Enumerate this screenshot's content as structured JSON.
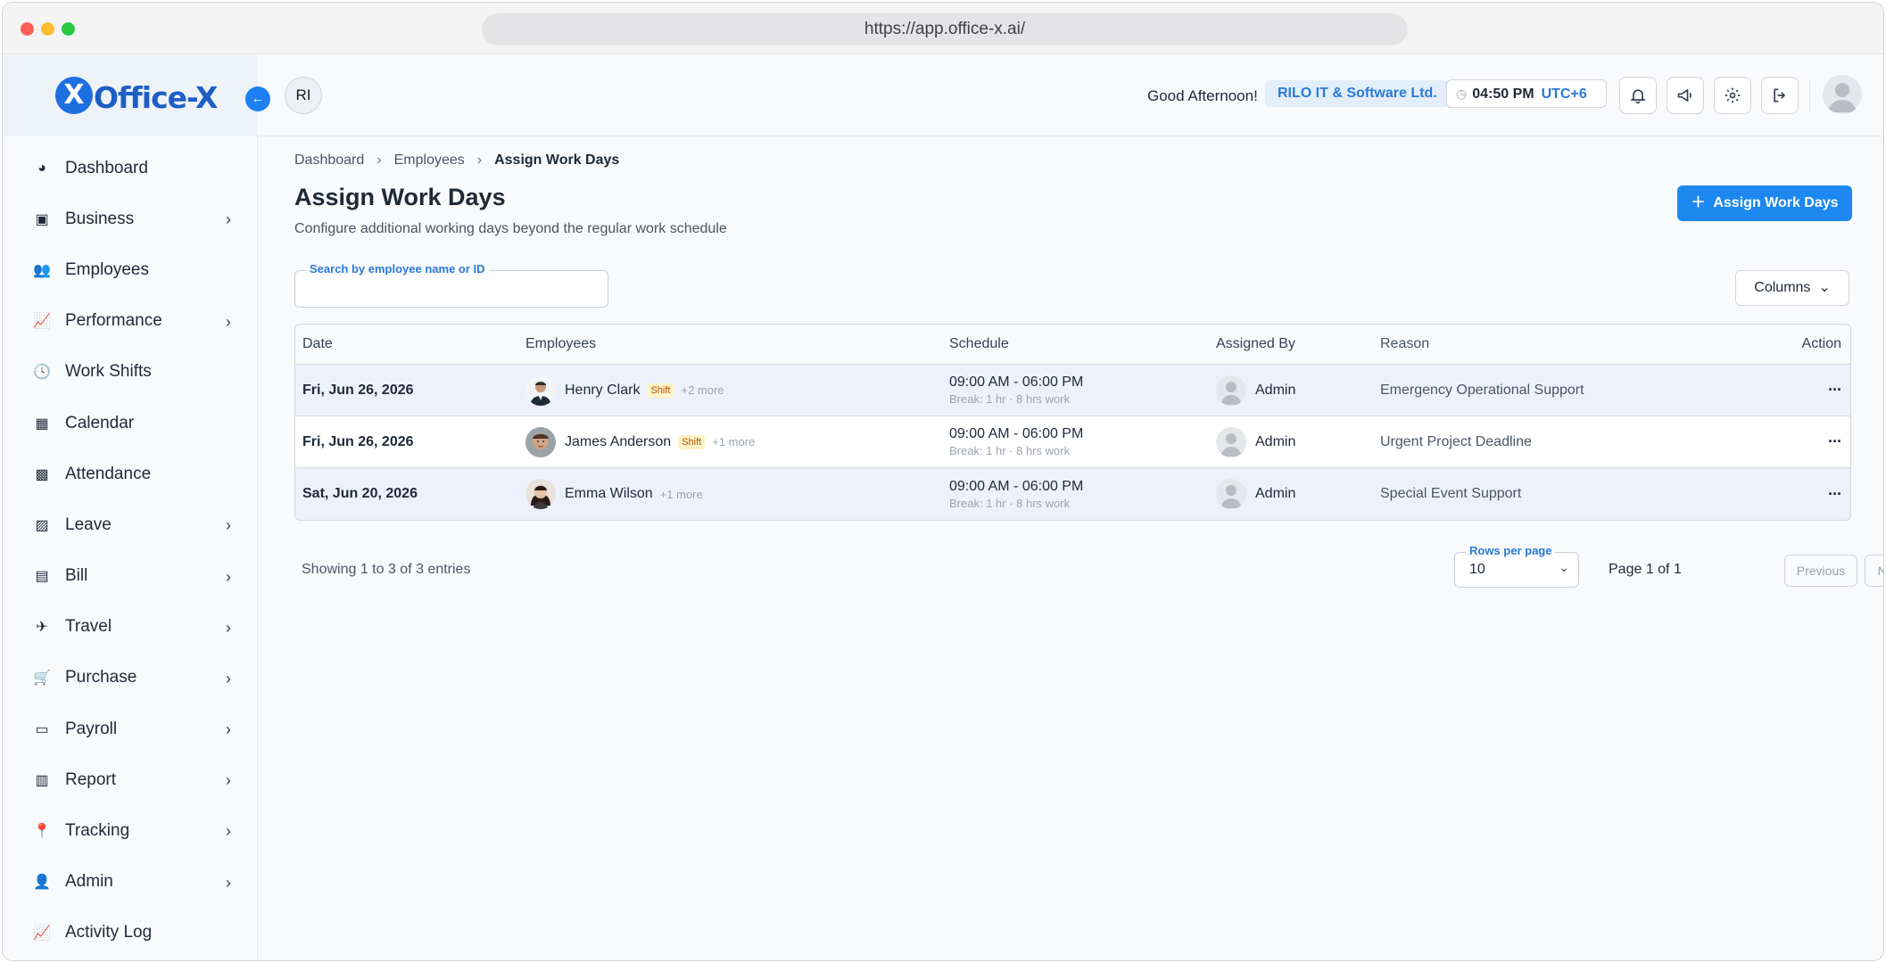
{
  "browser": {
    "url": "https://app.office-x.ai/"
  },
  "brand": {
    "mark": "X",
    "name": "Office-X"
  },
  "sidebar": {
    "items": [
      {
        "label": "Dashboard",
        "icon": "gauge-icon",
        "glyph": "◕",
        "has_children": false
      },
      {
        "label": "Business",
        "icon": "briefcase-icon",
        "glyph": "▣",
        "has_children": true
      },
      {
        "label": "Employees",
        "icon": "users-icon",
        "glyph": "👥",
        "has_children": false
      },
      {
        "label": "Performance",
        "icon": "chart-line-icon",
        "glyph": "📈",
        "has_children": true
      },
      {
        "label": "Work Shifts",
        "icon": "clock-icon",
        "glyph": "🕓",
        "has_children": false
      },
      {
        "label": "Calendar",
        "icon": "calendar-icon",
        "glyph": "▦",
        "has_children": false
      },
      {
        "label": "Attendance",
        "icon": "calendar-check-icon",
        "glyph": "▩",
        "has_children": false
      },
      {
        "label": "Leave",
        "icon": "calendar-x-icon",
        "glyph": "▨",
        "has_children": true
      },
      {
        "label": "Bill",
        "icon": "receipt-icon",
        "glyph": "▤",
        "has_children": true
      },
      {
        "label": "Travel",
        "icon": "plane-icon",
        "glyph": "✈",
        "has_children": true
      },
      {
        "label": "Purchase",
        "icon": "cart-icon",
        "glyph": "🛒",
        "has_children": true
      },
      {
        "label": "Payroll",
        "icon": "money-icon",
        "glyph": "▭",
        "has_children": true
      },
      {
        "label": "Report",
        "icon": "file-plus-icon",
        "glyph": "▥",
        "has_children": true
      },
      {
        "label": "Tracking",
        "icon": "pin-icon",
        "glyph": "📍",
        "has_children": true
      },
      {
        "label": "Admin",
        "icon": "user-gear-icon",
        "glyph": "👤",
        "has_children": true
      },
      {
        "label": "Activity Log",
        "icon": "activity-icon",
        "glyph": "📈",
        "has_children": false
      }
    ]
  },
  "header": {
    "initials": "RI",
    "greeting": "Good Afternoon!",
    "company": "RILO IT & Software Ltd.",
    "time": "04:50 PM",
    "timezone": "UTC+6"
  },
  "breadcrumb": {
    "items": [
      "Dashboard",
      "Employees"
    ],
    "current": "Assign Work Days"
  },
  "page": {
    "title": "Assign Work Days",
    "subtitle": "Configure additional working days beyond the regular work schedule",
    "primary_button": "Assign Work Days",
    "search_label": "Search by employee name or ID",
    "search_value": "",
    "columns_button": "Columns"
  },
  "table": {
    "headers": {
      "date": "Date",
      "employees": "Employees",
      "schedule": "Schedule",
      "assigned_by": "Assigned By",
      "reason": "Reason",
      "action": "Action"
    },
    "rows": [
      {
        "date": "Fri, Jun 26, 2026",
        "employee": "Henry Clark",
        "badge": "Shift",
        "more": "+2 more",
        "schedule": "09:00 AM - 06:00 PM",
        "schedule_sub": "Break: 1 hr · 8 hrs work",
        "assigned_by": "Admin",
        "reason": "Emergency Operational Support"
      },
      {
        "date": "Fri, Jun 26, 2026",
        "employee": "James Anderson",
        "badge": "Shift",
        "more": "+1 more",
        "schedule": "09:00 AM - 06:00 PM",
        "schedule_sub": "Break: 1 hr · 8 hrs work",
        "assigned_by": "Admin",
        "reason": "Urgent Project Deadline"
      },
      {
        "date": "Sat, Jun 20, 2026",
        "employee": "Emma Wilson",
        "badge": "",
        "more": "+1 more",
        "schedule": "09:00 AM - 06:00 PM",
        "schedule_sub": "Break: 1 hr · 8 hrs work",
        "assigned_by": "Admin",
        "reason": "Special Event Support"
      }
    ]
  },
  "pagination": {
    "showing": "Showing 1 to 3 of 3 entries",
    "rows_label": "Rows per page",
    "rows_value": "10",
    "page_info": "Page 1 of 1",
    "previous": "Previous",
    "next": "Next"
  }
}
